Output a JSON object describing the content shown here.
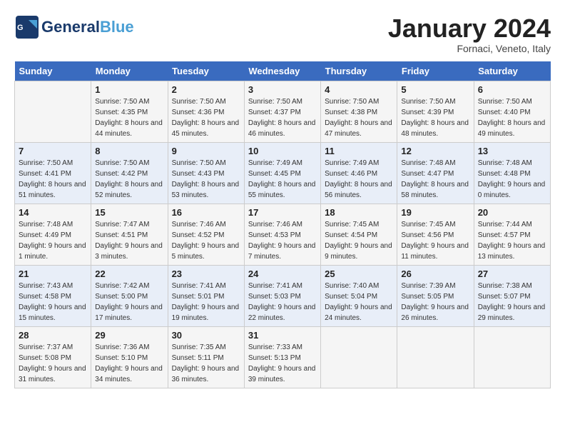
{
  "logo": {
    "name_part1": "General",
    "name_part2": "Blue",
    "tagline": ""
  },
  "header": {
    "title": "January 2024",
    "subtitle": "Fornaci, Veneto, Italy"
  },
  "weekdays": [
    "Sunday",
    "Monday",
    "Tuesday",
    "Wednesday",
    "Thursday",
    "Friday",
    "Saturday"
  ],
  "weeks": [
    [
      {
        "day": "",
        "sunrise": "",
        "sunset": "",
        "daylight": ""
      },
      {
        "day": "1",
        "sunrise": "Sunrise: 7:50 AM",
        "sunset": "Sunset: 4:35 PM",
        "daylight": "Daylight: 8 hours and 44 minutes."
      },
      {
        "day": "2",
        "sunrise": "Sunrise: 7:50 AM",
        "sunset": "Sunset: 4:36 PM",
        "daylight": "Daylight: 8 hours and 45 minutes."
      },
      {
        "day": "3",
        "sunrise": "Sunrise: 7:50 AM",
        "sunset": "Sunset: 4:37 PM",
        "daylight": "Daylight: 8 hours and 46 minutes."
      },
      {
        "day": "4",
        "sunrise": "Sunrise: 7:50 AM",
        "sunset": "Sunset: 4:38 PM",
        "daylight": "Daylight: 8 hours and 47 minutes."
      },
      {
        "day": "5",
        "sunrise": "Sunrise: 7:50 AM",
        "sunset": "Sunset: 4:39 PM",
        "daylight": "Daylight: 8 hours and 48 minutes."
      },
      {
        "day": "6",
        "sunrise": "Sunrise: 7:50 AM",
        "sunset": "Sunset: 4:40 PM",
        "daylight": "Daylight: 8 hours and 49 minutes."
      }
    ],
    [
      {
        "day": "7",
        "sunrise": "Sunrise: 7:50 AM",
        "sunset": "Sunset: 4:41 PM",
        "daylight": "Daylight: 8 hours and 51 minutes."
      },
      {
        "day": "8",
        "sunrise": "Sunrise: 7:50 AM",
        "sunset": "Sunset: 4:42 PM",
        "daylight": "Daylight: 8 hours and 52 minutes."
      },
      {
        "day": "9",
        "sunrise": "Sunrise: 7:50 AM",
        "sunset": "Sunset: 4:43 PM",
        "daylight": "Daylight: 8 hours and 53 minutes."
      },
      {
        "day": "10",
        "sunrise": "Sunrise: 7:49 AM",
        "sunset": "Sunset: 4:45 PM",
        "daylight": "Daylight: 8 hours and 55 minutes."
      },
      {
        "day": "11",
        "sunrise": "Sunrise: 7:49 AM",
        "sunset": "Sunset: 4:46 PM",
        "daylight": "Daylight: 8 hours and 56 minutes."
      },
      {
        "day": "12",
        "sunrise": "Sunrise: 7:48 AM",
        "sunset": "Sunset: 4:47 PM",
        "daylight": "Daylight: 8 hours and 58 minutes."
      },
      {
        "day": "13",
        "sunrise": "Sunrise: 7:48 AM",
        "sunset": "Sunset: 4:48 PM",
        "daylight": "Daylight: 9 hours and 0 minutes."
      }
    ],
    [
      {
        "day": "14",
        "sunrise": "Sunrise: 7:48 AM",
        "sunset": "Sunset: 4:49 PM",
        "daylight": "Daylight: 9 hours and 1 minute."
      },
      {
        "day": "15",
        "sunrise": "Sunrise: 7:47 AM",
        "sunset": "Sunset: 4:51 PM",
        "daylight": "Daylight: 9 hours and 3 minutes."
      },
      {
        "day": "16",
        "sunrise": "Sunrise: 7:46 AM",
        "sunset": "Sunset: 4:52 PM",
        "daylight": "Daylight: 9 hours and 5 minutes."
      },
      {
        "day": "17",
        "sunrise": "Sunrise: 7:46 AM",
        "sunset": "Sunset: 4:53 PM",
        "daylight": "Daylight: 9 hours and 7 minutes."
      },
      {
        "day": "18",
        "sunrise": "Sunrise: 7:45 AM",
        "sunset": "Sunset: 4:54 PM",
        "daylight": "Daylight: 9 hours and 9 minutes."
      },
      {
        "day": "19",
        "sunrise": "Sunrise: 7:45 AM",
        "sunset": "Sunset: 4:56 PM",
        "daylight": "Daylight: 9 hours and 11 minutes."
      },
      {
        "day": "20",
        "sunrise": "Sunrise: 7:44 AM",
        "sunset": "Sunset: 4:57 PM",
        "daylight": "Daylight: 9 hours and 13 minutes."
      }
    ],
    [
      {
        "day": "21",
        "sunrise": "Sunrise: 7:43 AM",
        "sunset": "Sunset: 4:58 PM",
        "daylight": "Daylight: 9 hours and 15 minutes."
      },
      {
        "day": "22",
        "sunrise": "Sunrise: 7:42 AM",
        "sunset": "Sunset: 5:00 PM",
        "daylight": "Daylight: 9 hours and 17 minutes."
      },
      {
        "day": "23",
        "sunrise": "Sunrise: 7:41 AM",
        "sunset": "Sunset: 5:01 PM",
        "daylight": "Daylight: 9 hours and 19 minutes."
      },
      {
        "day": "24",
        "sunrise": "Sunrise: 7:41 AM",
        "sunset": "Sunset: 5:03 PM",
        "daylight": "Daylight: 9 hours and 22 minutes."
      },
      {
        "day": "25",
        "sunrise": "Sunrise: 7:40 AM",
        "sunset": "Sunset: 5:04 PM",
        "daylight": "Daylight: 9 hours and 24 minutes."
      },
      {
        "day": "26",
        "sunrise": "Sunrise: 7:39 AM",
        "sunset": "Sunset: 5:05 PM",
        "daylight": "Daylight: 9 hours and 26 minutes."
      },
      {
        "day": "27",
        "sunrise": "Sunrise: 7:38 AM",
        "sunset": "Sunset: 5:07 PM",
        "daylight": "Daylight: 9 hours and 29 minutes."
      }
    ],
    [
      {
        "day": "28",
        "sunrise": "Sunrise: 7:37 AM",
        "sunset": "Sunset: 5:08 PM",
        "daylight": "Daylight: 9 hours and 31 minutes."
      },
      {
        "day": "29",
        "sunrise": "Sunrise: 7:36 AM",
        "sunset": "Sunset: 5:10 PM",
        "daylight": "Daylight: 9 hours and 34 minutes."
      },
      {
        "day": "30",
        "sunrise": "Sunrise: 7:35 AM",
        "sunset": "Sunset: 5:11 PM",
        "daylight": "Daylight: 9 hours and 36 minutes."
      },
      {
        "day": "31",
        "sunrise": "Sunrise: 7:33 AM",
        "sunset": "Sunset: 5:13 PM",
        "daylight": "Daylight: 9 hours and 39 minutes."
      },
      {
        "day": "",
        "sunrise": "",
        "sunset": "",
        "daylight": ""
      },
      {
        "day": "",
        "sunrise": "",
        "sunset": "",
        "daylight": ""
      },
      {
        "day": "",
        "sunrise": "",
        "sunset": "",
        "daylight": ""
      }
    ]
  ]
}
